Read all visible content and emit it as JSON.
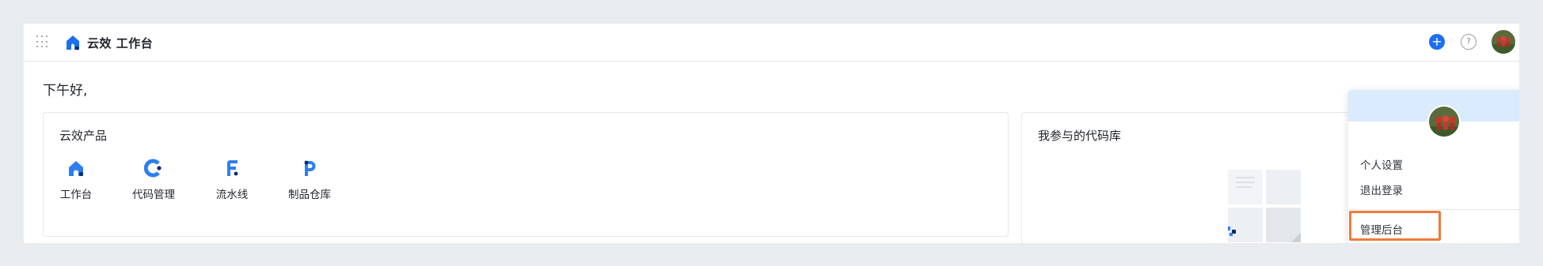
{
  "header": {
    "app_title": "云效 工作台",
    "plus_label": "+",
    "help_label": "?"
  },
  "greeting": "下午好,",
  "products": {
    "title": "云效产品",
    "items": [
      {
        "label": "工作台",
        "icon": "workbench-icon"
      },
      {
        "label": "代码管理",
        "icon": "code-icon"
      },
      {
        "label": "流水线",
        "icon": "pipeline-icon"
      },
      {
        "label": "制品仓库",
        "icon": "artifact-icon"
      }
    ]
  },
  "repos": {
    "title": "我参与的代码库"
  },
  "user_menu": {
    "items": {
      "settings": "个人设置",
      "logout": "退出登录",
      "admin": "管理后台"
    }
  },
  "colors": {
    "accent": "#1b6ef3",
    "highlight": "#f07b3a",
    "banner": "#d9ebfc"
  }
}
